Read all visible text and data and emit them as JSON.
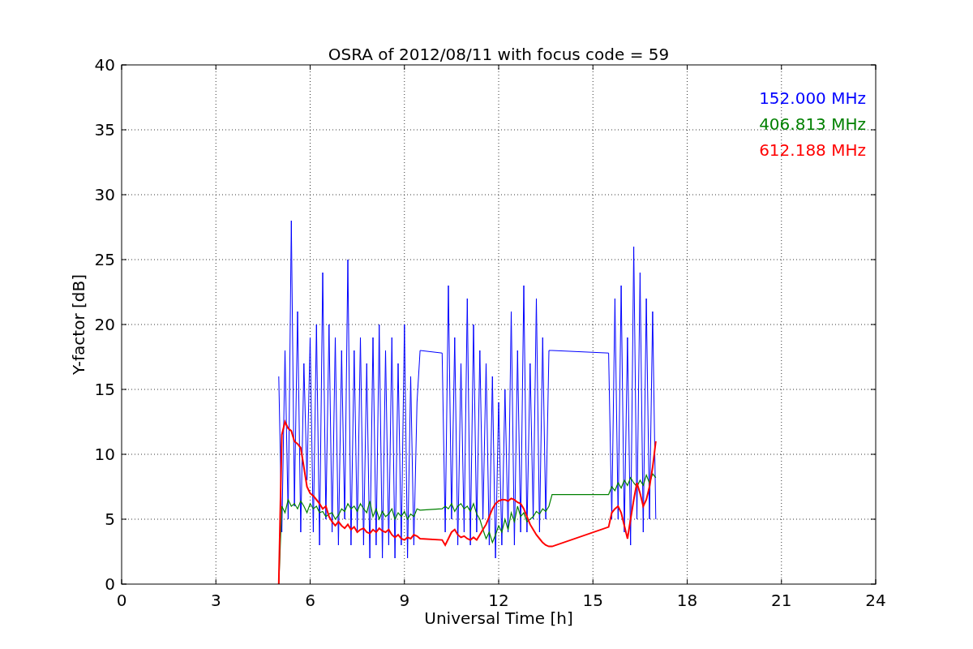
{
  "figure": {
    "chart_data": {
      "type": "line",
      "title": "OSRA of 2012/08/11 with focus code = 59",
      "xlabel": "Universal Time [h]",
      "ylabel": "Y-factor [dB]",
      "xlim": [
        0,
        24
      ],
      "ylim": [
        0,
        40
      ],
      "grid": true,
      "xticks": [
        0,
        3,
        6,
        9,
        12,
        15,
        18,
        21,
        24
      ],
      "yticks": [
        0,
        5,
        10,
        15,
        20,
        25,
        30,
        35,
        40
      ],
      "x": [
        5,
        5.1,
        5.2,
        5.3,
        5.4,
        5.5,
        5.6,
        5.7,
        5.8,
        5.9,
        6,
        6.1,
        6.2,
        6.3,
        6.4,
        6.5,
        6.6,
        6.7,
        6.8,
        6.9,
        7,
        7.1,
        7.2,
        7.3,
        7.4,
        7.5,
        7.6,
        7.7,
        7.8,
        7.9,
        8,
        8.1,
        8.2,
        8.3,
        8.4,
        8.5,
        8.6,
        8.7,
        8.8,
        8.9,
        9,
        9.1,
        9.2,
        9.3,
        9.4,
        9.5,
        10.2,
        10.3,
        10.4,
        10.5,
        10.6,
        10.7,
        10.8,
        10.9,
        11,
        11.1,
        11.2,
        11.3,
        11.4,
        11.5,
        11.6,
        11.7,
        11.8,
        11.9,
        12,
        12.1,
        12.2,
        12.3,
        12.4,
        12.5,
        12.6,
        12.7,
        12.8,
        12.9,
        13,
        13.1,
        13.2,
        13.3,
        13.4,
        13.5,
        13.6,
        13.7,
        15.5,
        15.6,
        15.7,
        15.8,
        15.9,
        16,
        16.1,
        16.2,
        16.3,
        16.4,
        16.5,
        16.6,
        16.7,
        16.8,
        16.9,
        17
      ],
      "series": [
        {
          "name": "152.000 MHz",
          "color": "#0000ff",
          "values": [
            16,
            4,
            18,
            5,
            28,
            6,
            21,
            4,
            17,
            8,
            19,
            4,
            20,
            3,
            24,
            5,
            20,
            4,
            19,
            3,
            18,
            5,
            25,
            3,
            18,
            4,
            19,
            3,
            17,
            2,
            19,
            3,
            20,
            2,
            18,
            3,
            19,
            2,
            17,
            3,
            20,
            2,
            16,
            3,
            14,
            18,
            17.8,
            4,
            23,
            5,
            19,
            3,
            17,
            4,
            22,
            3,
            20,
            4,
            18,
            5,
            17,
            3,
            16,
            2,
            14,
            3,
            15,
            4,
            21,
            3,
            18,
            4,
            23,
            4,
            17,
            5,
            22,
            4,
            19,
            5,
            18,
            18,
            17.8,
            5,
            22,
            5,
            23,
            4,
            19,
            3,
            26,
            5,
            24,
            4,
            22,
            5,
            21,
            5
          ]
        },
        {
          "name": "406.813 MHz",
          "color": "#008000",
          "values": [
            0,
            6,
            5.5,
            6.5,
            6,
            6.2,
            5.8,
            6.4,
            6,
            5.5,
            6.2,
            5.8,
            6,
            5.5,
            5.6,
            5.2,
            5.4,
            5.5,
            5,
            5.3,
            5.8,
            5.6,
            6.2,
            5.8,
            6,
            5.6,
            6.2,
            5.8,
            5.5,
            6.4,
            5.2,
            5.8,
            5,
            5.6,
            5.2,
            5.4,
            5.8,
            5,
            5.5,
            5.2,
            5.6,
            5,
            5.4,
            5.2,
            5.8,
            5.7,
            5.8,
            6,
            5.8,
            6.2,
            5.6,
            6,
            6.2,
            5.8,
            6,
            5.6,
            6.2,
            5.4,
            5,
            4.2,
            3.5,
            4,
            3.2,
            3.8,
            4.5,
            4,
            5,
            4.2,
            5.5,
            4.8,
            6,
            5.2,
            5.5,
            4.8,
            5,
            5.2,
            5.6,
            5.4,
            5.8,
            5.6,
            6,
            6.9,
            6.9,
            7.5,
            7.2,
            7.8,
            7.4,
            8,
            7.6,
            8.2,
            7.8,
            7.5,
            8,
            7.6,
            8.4,
            7.8,
            8.5,
            8.2
          ]
        },
        {
          "name": "612.188 MHz",
          "color": "#ff0000",
          "values": [
            0,
            11.5,
            12.5,
            12,
            11.8,
            11,
            10.8,
            10.5,
            9,
            7.5,
            7,
            6.8,
            6.5,
            6.2,
            5.8,
            6,
            5.2,
            4.8,
            4.5,
            4.8,
            4.5,
            4.3,
            4.6,
            4.2,
            4.4,
            4,
            4.2,
            4.3,
            4,
            3.9,
            4.2,
            4,
            4.3,
            4.1,
            4,
            4.2,
            3.8,
            3.6,
            3.8,
            3.5,
            3.4,
            3.6,
            3.5,
            3.8,
            3.7,
            3.5,
            3.4,
            3,
            3.5,
            4,
            4.2,
            3.8,
            3.6,
            3.7,
            3.5,
            3.4,
            3.6,
            3.4,
            3.8,
            4.2,
            4.6,
            5.2,
            5.8,
            6.2,
            6.4,
            6.5,
            6.5,
            6.4,
            6.6,
            6.5,
            6.3,
            6.2,
            5.8,
            5.2,
            4.6,
            4.2,
            3.8,
            3.5,
            3.2,
            3,
            2.9,
            2.9,
            4.4,
            5.5,
            5.8,
            6,
            5.5,
            4.5,
            3.5,
            5,
            6.5,
            7.8,
            7,
            6,
            6.5,
            7.5,
            9,
            11
          ]
        }
      ]
    }
  }
}
